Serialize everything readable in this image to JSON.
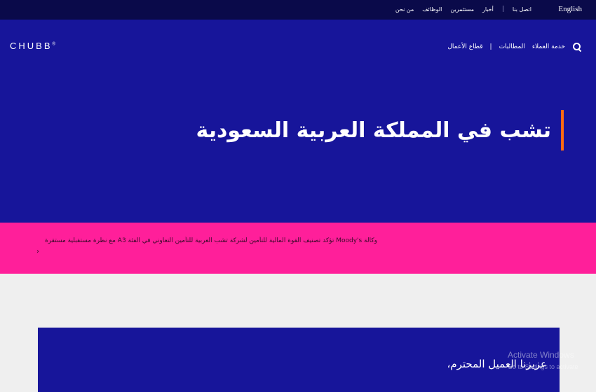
{
  "topbar": {
    "language_link": "English",
    "links": [
      "اتصل بنا",
      "أخبار",
      "مستثمرين",
      "الوظائف",
      "من نحن"
    ]
  },
  "header": {
    "logo": "CHUBB",
    "logo_mark": "®",
    "nav": [
      "خدمة العملاء",
      "المطالبات",
      "قطاع الأعمال"
    ]
  },
  "hero": {
    "title": "تشب في المملكة العربية السعودية"
  },
  "alert": {
    "text": "وكالة Moody's تؤكد تصنيف القوة المالية للتأمين لشركة تشب العربية للتأمين التعاوني في الفئة A3 مع نظرة مستقبلية مستقرة",
    "arrow": "›"
  },
  "card": {
    "greeting": "عزيزنا العميل المحترم،"
  },
  "watermark": {
    "line1": "Activate Windows",
    "line2": "Go to Settings to activate"
  },
  "colors": {
    "topbar": "#0a0a4a",
    "brand_blue": "#17159a",
    "accent_orange": "#ff6a13",
    "alert_pink": "#ff1f9a",
    "page_gray": "#efefef"
  }
}
